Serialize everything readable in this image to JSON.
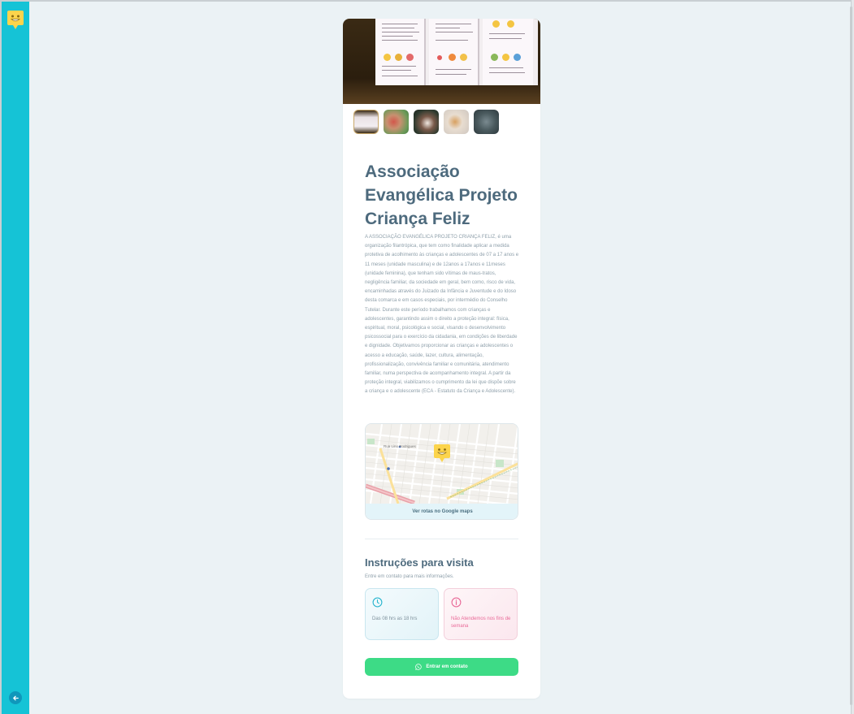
{
  "org": {
    "title": "Associação Evangélica Projeto Criança Feliz",
    "description": "A ASSOCIAÇÃO EVANGÉLICA PROJETO CRIANÇA FELIZ, é uma organização filantrópica, que tem como finalidade aplicar a medida protetiva de acolhimento às crianças e adolescentes de 07 a 17 anos e 11 meses (unidade masculina) e de 12anos a 17anos e 11meses (unidade feminina), que tenham sido vítimas de maus-tratos, negligência familiar, da sociedade em geral, bem como, risco de vida, encaminhadas através do Juizado da Infância e Juventude e do Idoso desta comarca e em casos especiais, por intermédio do Conselho Tutelar. Durante este período trabalhamos com crianças e adolescentes, garantindo assim o direito a proteção integral: física, espiritual, moral, psicológica e social, visando o desenvolvimento psicossocial para o exercício da cidadania, em condições de liberdade e dignidade. Objetivamos proporcionar as crianças e adolescentes o acesso a educação, saúde, lazer, cultura, alimentação, profissionalização, convivência familiar e comunitária, atendimento familiar, numa perspectiva de acompanhamento integral. A partir da proteção integral, viabilizamos o cumprimento da lei que dispõe sobre a criança e o adolescente (ECA - Estatuto da Criança e Adolescente)."
  },
  "map": {
    "link_label": "Ver rotas no Google maps",
    "street_label": "Rua Lino Rodrigues"
  },
  "visit": {
    "title": "Instruções para visita",
    "subtitle": "Entre em contato para mais informações.",
    "hours": "Das 08 hrs as 18 hrs",
    "note": "Não Atendemos nos fins de semana"
  },
  "contact": {
    "label": "Entrar em contato"
  },
  "colors": {
    "sidebar": "#15c3d6",
    "brand_yellow": "#fcd44c",
    "whatsapp_green": "#3ddb86",
    "time_accent": "#2cb6cf",
    "note_accent": "#e96a98"
  },
  "icons": {
    "logo": "smiley-pin-icon",
    "back": "arrow-left-icon",
    "clock": "clock-icon",
    "info": "info-icon",
    "whatsapp": "whatsapp-icon"
  }
}
